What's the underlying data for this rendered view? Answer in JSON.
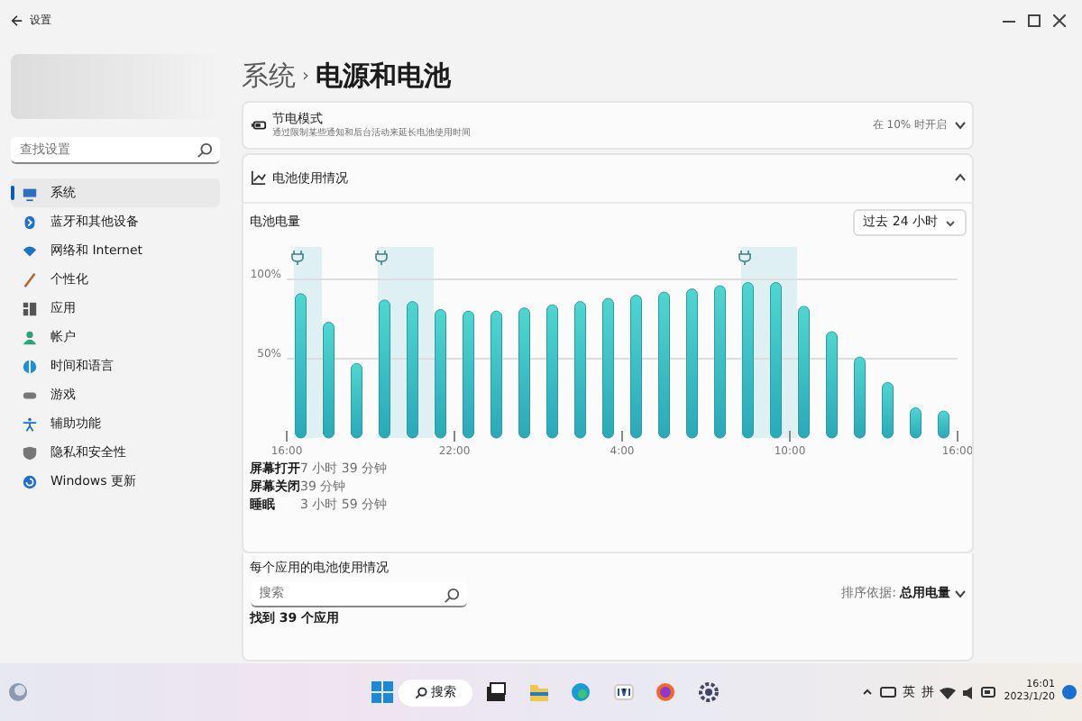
{
  "window": {
    "title": "设置"
  },
  "sidebar": {
    "search": {
      "placeholder": "查找设置"
    },
    "items": [
      {
        "label": "系统",
        "selected": true
      },
      {
        "label": "蓝牙和其他设备",
        "selected": false
      },
      {
        "label": "网络和 Internet",
        "selected": false
      },
      {
        "label": "个性化",
        "selected": false
      },
      {
        "label": "应用",
        "selected": false
      },
      {
        "label": "帐户",
        "selected": false
      },
      {
        "label": "时间和语言",
        "selected": false
      },
      {
        "label": "游戏",
        "selected": false
      },
      {
        "label": "辅助功能",
        "selected": false
      },
      {
        "label": "隐私和安全性",
        "selected": false
      },
      {
        "label": "Windows 更新",
        "selected": false
      }
    ]
  },
  "breadcrumb": {
    "parent": "系统",
    "separator": "›",
    "current": "电源和电池"
  },
  "battery_saver": {
    "title": "节电模式",
    "subtitle": "通过限制某些通知和后台活动来延长电池使用时间",
    "value": "在 10% 时开启",
    "expanded": false
  },
  "battery_usage": {
    "title": "电池使用情况",
    "expanded": true,
    "level_label": "电池电量",
    "range": "过去 24 小时",
    "charging": [
      true,
      false,
      false,
      true,
      true,
      false,
      false,
      false,
      false,
      false,
      false,
      false,
      false,
      false,
      false,
      false,
      true,
      true,
      false,
      false,
      false,
      false,
      false,
      false
    ],
    "chart_data": {
      "type": "bar",
      "categories": [
        "16:00",
        null,
        null,
        null,
        null,
        null,
        "22:00",
        null,
        null,
        null,
        null,
        null,
        "4:00",
        null,
        null,
        null,
        null,
        null,
        "10:00",
        null,
        null,
        null,
        null,
        null,
        "16:00"
      ],
      "values": [
        91,
        73,
        47,
        87,
        86,
        81,
        80,
        80,
        82,
        84,
        86,
        88,
        90,
        92,
        94,
        96,
        98,
        98,
        83,
        67,
        51,
        35,
        19,
        17,
        null
      ],
      "ylim": [
        0,
        100
      ],
      "yticks": [
        {
          "value": 50,
          "label": "50%"
        },
        {
          "value": 100,
          "label": "100%"
        }
      ]
    },
    "stats": [
      {
        "label": "屏幕打开",
        "value": "7 小时 39 分钟"
      },
      {
        "label": "屏幕关闭",
        "value": "39 分钟"
      },
      {
        "label": "睡眠",
        "value": "3 小时 59 分钟"
      }
    ]
  },
  "app_usage": {
    "title": "每个应用的电池使用情况",
    "search": {
      "placeholder": "搜索"
    },
    "sort_label": "排序依据:",
    "sort_value": "总用电量",
    "found": "找到 39 个应用"
  },
  "taskbar": {
    "search_label": "搜索",
    "tray": [
      "英",
      "拼"
    ],
    "time": "16:01",
    "date": "2023/1/20"
  }
}
